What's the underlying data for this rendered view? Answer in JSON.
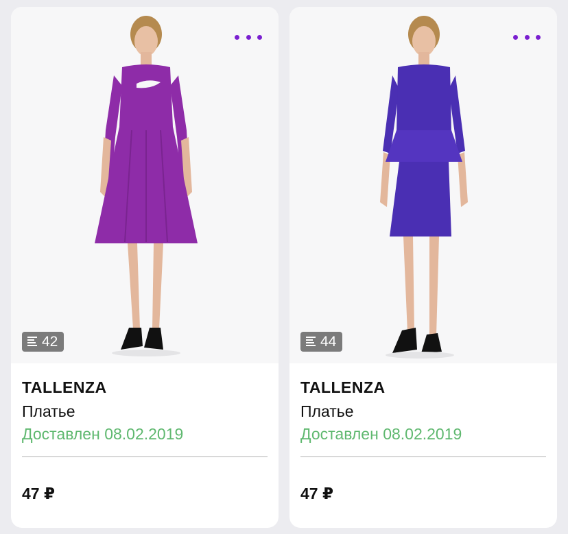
{
  "cards": [
    {
      "brand": "TALLENZA",
      "product_type": "Платье",
      "status": "Доставлен 08.02.2019",
      "price": "47 ₽",
      "size": "42",
      "more_icon": "ellipsis-icon",
      "size_icon": "size-lines-icon",
      "dress_color": "#8e2ca8",
      "status_color": "#5fb86f"
    },
    {
      "brand": "TALLENZA",
      "product_type": "Платье",
      "status": "Доставлен 08.02.2019",
      "price": "47 ₽",
      "size": "44",
      "more_icon": "ellipsis-icon",
      "size_icon": "size-lines-icon",
      "dress_color": "#4a2fb3",
      "status_color": "#5fb86f"
    }
  ],
  "accent_color": "#7a1fd0"
}
